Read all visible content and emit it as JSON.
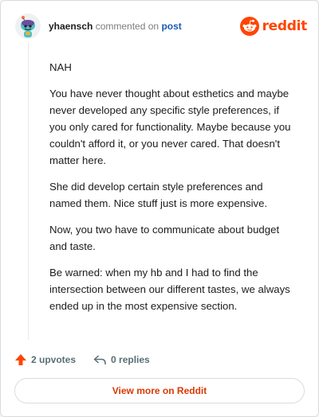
{
  "header": {
    "author": "yhaensch",
    "verb": "commented on",
    "post_link": "post",
    "brand": "reddit"
  },
  "comment": {
    "paragraphs": [
      "NAH",
      "You have never thought about esthetics and maybe never developed any specific style preferences, if you only cared for functionality. Maybe because you couldn't afford it, or you never cared. That doesn't matter here.",
      "She did develop certain style preferences and named them. Nice stuff just is more expensive.",
      "Now, you two have to communicate about budget and taste.",
      "Be warned: when my hb and I had to find the intersection between our different tastes, we always ended up in the most expensive section."
    ]
  },
  "actions": {
    "upvotes": "2 upvotes",
    "replies": "0 replies"
  },
  "footer": {
    "view_more": "View more on Reddit"
  },
  "colors": {
    "brand": "#ff4500",
    "link": "#1a5ab8",
    "upvote": "#ff4500"
  },
  "icons": {
    "avatar": "snoo-avatar",
    "logo": "reddit-logo-icon",
    "upvote": "upvote-arrow-icon",
    "reply": "reply-arrow-icon"
  }
}
